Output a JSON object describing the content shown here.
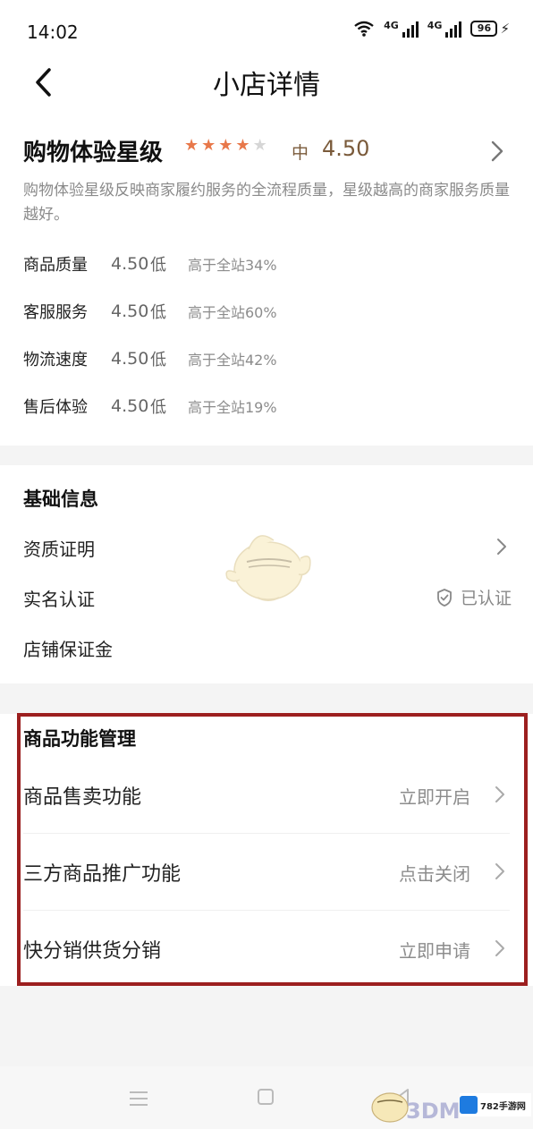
{
  "status_bar": {
    "time": "14:02",
    "net1": "4G",
    "net2": "4G",
    "battery": "96"
  },
  "header": {
    "title": "小店详情"
  },
  "rating": {
    "title": "购物体验星级",
    "stars_filled": 4,
    "stars_total": 5,
    "level": "中",
    "score": "4.50",
    "description": "购物体验星级反映商家履约服务的全流程质量，星级越高的商家服务质量越好。",
    "metrics": [
      {
        "name": "商品质量",
        "score": "4.50",
        "level": "低",
        "compare": "高于全站34%"
      },
      {
        "name": "客服服务",
        "score": "4.50",
        "level": "低",
        "compare": "高于全站60%"
      },
      {
        "name": "物流速度",
        "score": "4.50",
        "level": "低",
        "compare": "高于全站42%"
      },
      {
        "name": "售后体验",
        "score": "4.50",
        "level": "低",
        "compare": "高于全站19%"
      }
    ]
  },
  "basic_info": {
    "title": "基础信息",
    "qualification": "资质证明",
    "real_name": "实名认证",
    "real_name_status": "已认证",
    "deposit": "店铺保证金"
  },
  "functions": {
    "title": "商品功能管理",
    "items": [
      {
        "label": "商品售卖功能",
        "action": "立即开启"
      },
      {
        "label": "三方商品推广功能",
        "action": "点击关闭"
      },
      {
        "label": "快分销供货分销",
        "action": "立即申请"
      }
    ]
  },
  "watermarks": {
    "brand_3dm": "3DM",
    "brand_782": "782手游网"
  },
  "colors": {
    "star": "#e8784a",
    "highlight_border": "#9c1f1f",
    "page_bg": "#f4f4f4"
  }
}
